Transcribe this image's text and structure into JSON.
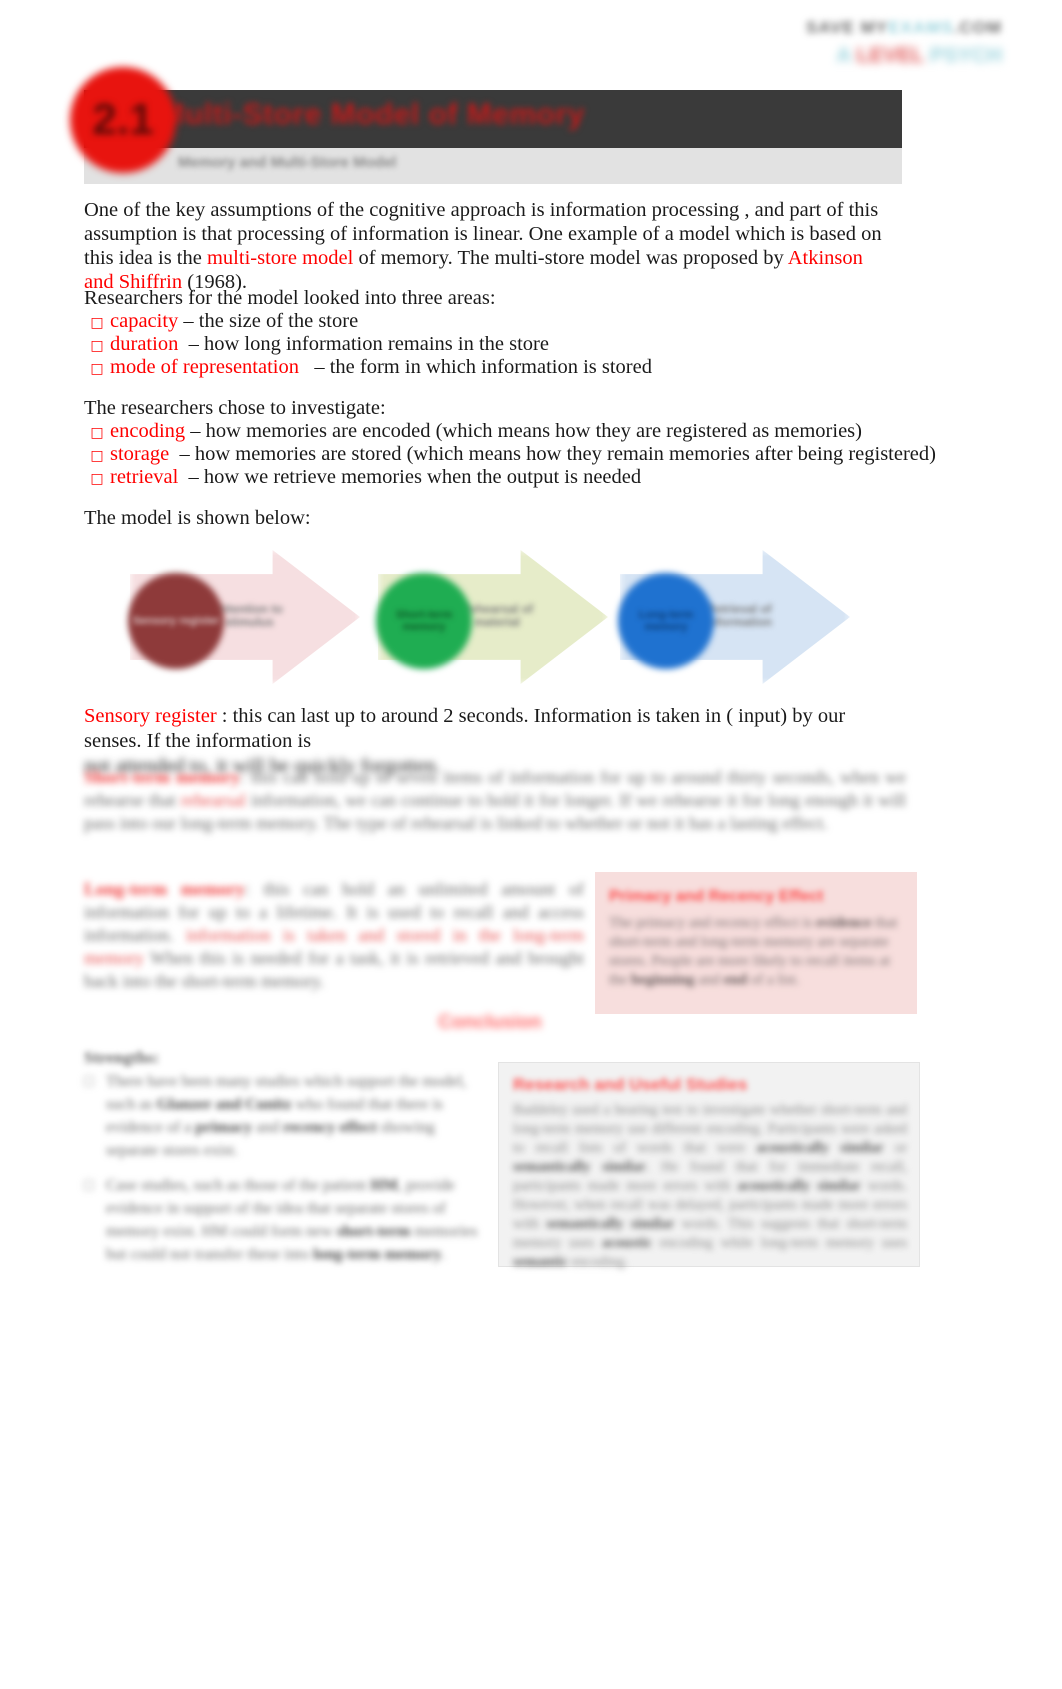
{
  "document": {
    "watermark": {
      "line1_prefix": "SAVE MY",
      "line1_accent": "EXAMS",
      "line1_suffix": ".COM",
      "line2_prefix": "A ",
      "line2_red": "LEVEL",
      "line2_accent": " PSYCH"
    },
    "header": {
      "badge_number": "2.1",
      "title": "The Multi-Store Model of Memory",
      "subtitle": "Memory and Multi-Store Model"
    },
    "intro": {
      "part1": "One of the key assumptions of the cognitive approach is  information processing , and part of this assumption is that processing of information is linear. One example of a model which is based on this idea is the ",
      "highlight1": " multi-store model ",
      "part2": " of memory. The multi-store model was proposed by ",
      "highlight2": " Atkinson and Shiffrin ",
      "part3": " (1968)."
    },
    "areas": {
      "lead": "Researchers for the model looked into three areas:",
      "bullet_glyph": "□",
      "items": [
        {
          "term": "capacity ",
          "desc": "– the size of the store"
        },
        {
          "term": "duration ",
          "desc": " – how long information remains in the store"
        },
        {
          "term": "mode of representation ",
          "desc": "  – the form in which information is stored"
        }
      ]
    },
    "investigate": {
      "lead": "The researchers chose to investigate:",
      "items": [
        {
          "term": "encoding ",
          "desc": "– how memories are encoded (which means how they are registered as memories)"
        },
        {
          "term": "storage ",
          "desc": " – how memories are stored (which means how they remain memories after being registered)"
        },
        {
          "term": "retrieval ",
          "desc": " – how we retrieve memories when the output is needed"
        }
      ]
    },
    "model_lead": "The model is shown below:",
    "diagram": {
      "stages": [
        {
          "circle_label": "Sensory\nregister",
          "chevron_label": "Attention to\nstimulus",
          "circle_color": "#8e3a3a",
          "chevron_color": "#f6dfe1"
        },
        {
          "circle_label": "Short-term\nmemory",
          "chevron_label": "Rehearsal\nof material",
          "circle_color": "#1fad52",
          "chevron_color": "#e6ecc9"
        },
        {
          "circle_label": "Long-term\nmemory",
          "chevron_label": "Retrieval of\ninformation",
          "circle_color": "#1f72d0",
          "chevron_color": "#d6e4f4"
        }
      ]
    },
    "sensory": {
      "label": "Sensory register",
      "text": " : this can last up to around 2 seconds. Information is taken in ( input) by our senses. If the information is",
      "blurred_tail": "not attended to, it will be quickly forgotten."
    },
    "stm_paragraph": {
      "highlight_start": "Short-term memory",
      "rest_a": ": this can hold up to seven items of information for up to around thirty seconds, when we rehearse that",
      "highlight_mid": "rehearsal",
      "rest_b": " information, we can continue to  hold it for longer. If we rehearse it for long enough it will pass into our long-term memory. The type of rehearsal is linked to whether or not it has a lasting effect."
    },
    "ltm_paragraph": {
      "highlight_start": "Long-term memory",
      "rest_a": ": this can hold an unlimited amount of information for up to a lifetime. It is used to recall and access information.",
      "highlight_mid": "information is taken and stored in the long-term memory",
      "rest_b": " When this is needed for a task, it is retrieved and brought back into the short-term memory."
    },
    "callout": {
      "title": "Primacy and Recency Effect",
      "body_a": "The primacy and recency effect is ",
      "body_b": "evidence",
      "body_c": " that short-term and long-term memory are separate stores. People are more likely to recall items at the ",
      "body_d": "beginning",
      "body_e": " and ",
      "body_f": "end",
      "body_g": " of a list."
    },
    "conclusion_label": "Conclusion",
    "evaluation": {
      "heading": "Strengths:",
      "bullet_glyph": "□",
      "items": [
        {
          "text_a": "There have been many studies which support the model, such as ",
          "bold1": "Glanzer and Cunitz",
          "text_b": " who found that there is evidence of a ",
          "bold2": "primacy",
          "text_c": " and ",
          "bold3": "recency effect",
          "text_d": " showing separate stores exist."
        },
        {
          "text_a": "Case studies, such as those of the patient ",
          "bold1": "HM",
          "text_b": ", provide evidence in support of the idea that separate stores of memory exist. HM could form new ",
          "bold2": "short-term",
          "text_c": " memories but could not transfer these into ",
          "bold3": "long-term memory",
          "text_d": "."
        }
      ]
    },
    "box_right": {
      "title": "Research and Useful Studies",
      "body_a": "Baddeley used a hearing test to investigate whether short-term and long-term memory use different encoding. Participants were asked to recall lists of words that were ",
      "bold1": "acoustically similar",
      "body_b": " or ",
      "bold2": "semantically similar",
      "body_c": ". He found that for immediate recall, participants made more errors with ",
      "bold3": "acoustically similar",
      "body_d": " words. However, when recall was delayed, participants made more errors with ",
      "bold4": "semantically similar",
      "body_e": " words. This suggests that short-term memory uses ",
      "bold5": "acoustic",
      "body_f": " encoding while long-term memory uses ",
      "bold6": "semantic",
      "body_g": " encoding."
    }
  }
}
